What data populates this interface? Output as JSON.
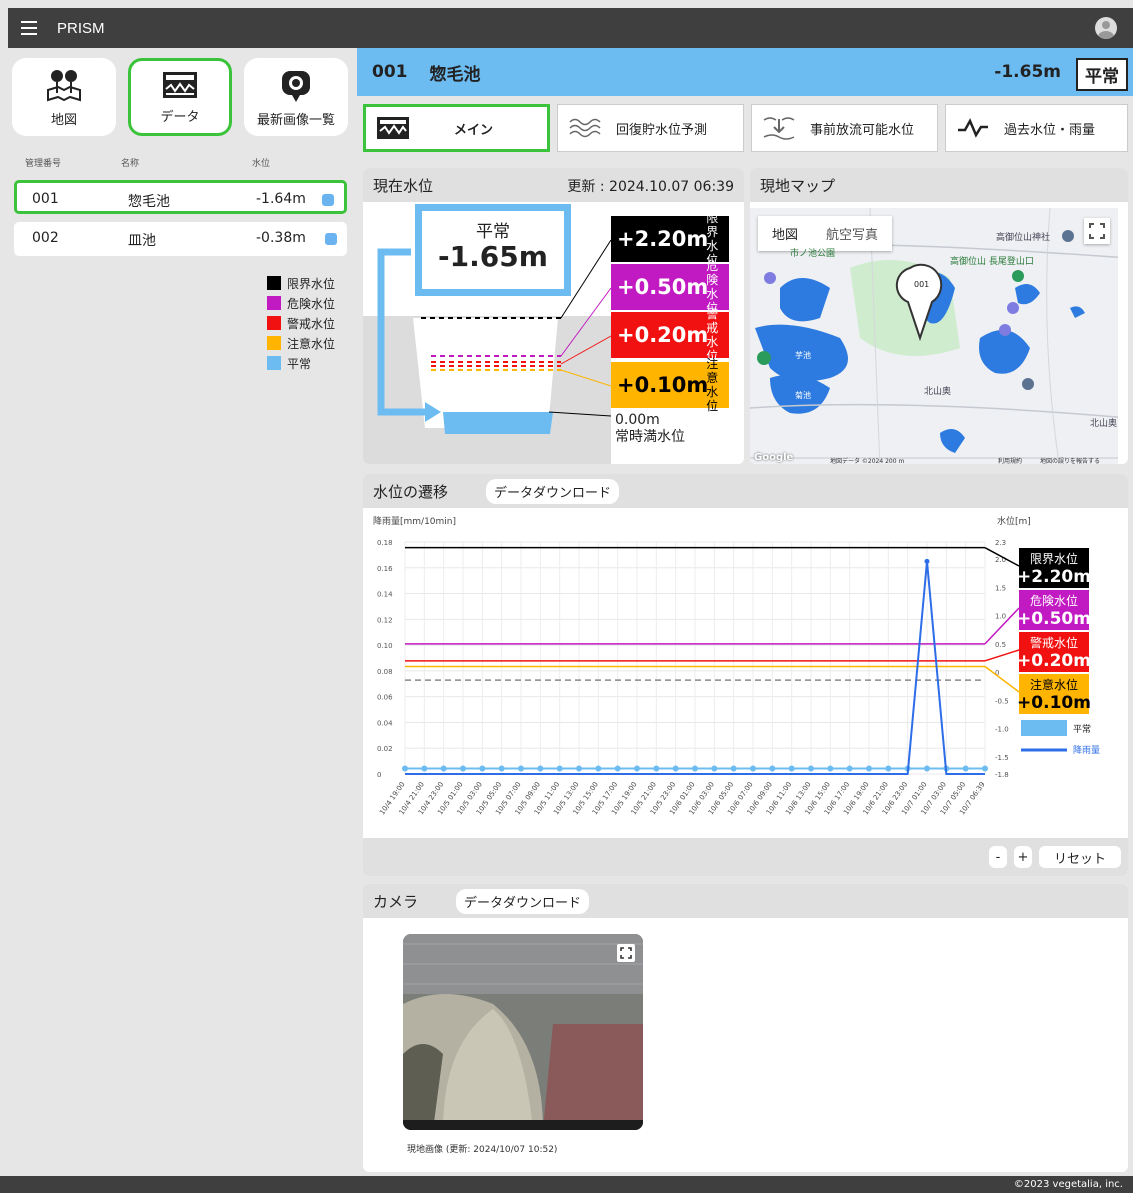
{
  "app": {
    "title": "PRISM"
  },
  "nav": [
    {
      "label": "地図"
    },
    {
      "label": "データ"
    },
    {
      "label": "最新画像一覧"
    }
  ],
  "list": {
    "headers": {
      "id": "管理番号",
      "name": "名称",
      "level": "水位"
    },
    "rows": [
      {
        "id": "001",
        "name": "惣毛池",
        "level": "-1.64m"
      },
      {
        "id": "002",
        "name": "皿池",
        "level": "-0.38m"
      }
    ]
  },
  "legend": [
    {
      "label": "限界水位",
      "color": "#000000"
    },
    {
      "label": "危険水位",
      "color": "#c21ac2"
    },
    {
      "label": "警戒水位",
      "color": "#f21111"
    },
    {
      "label": "注意水位",
      "color": "#ffb400"
    },
    {
      "label": "平常",
      "color": "#6cbcf2"
    }
  ],
  "header": {
    "id": "001",
    "name": "惣毛池",
    "level": "-1.65m",
    "status": "平常"
  },
  "tabs": [
    {
      "label": "メイン"
    },
    {
      "label": "回復貯水位予測"
    },
    {
      "label": "事前放流可能水位"
    },
    {
      "label": "過去水位・雨量"
    }
  ],
  "current": {
    "title": "現在水位",
    "updated": "更新 : 2024.10.07 06:39",
    "status": "平常",
    "value": "-1.65m",
    "thresholds": [
      {
        "value": "+2.20m",
        "label": "限界水位",
        "color": "#000000"
      },
      {
        "value": "+0.50m",
        "label": "危険水位",
        "color": "#c21ac2"
      },
      {
        "value": "+0.20m",
        "label": "警戒水位",
        "color": "#f21111"
      },
      {
        "value": "+0.10m",
        "label": "注意水位",
        "color": "#ffb400"
      }
    ],
    "base_value": "0.00m",
    "base_label": "常時満水位"
  },
  "map": {
    "title": "現地マップ",
    "btn_map": "地図",
    "btn_photo": "航空写真",
    "marker": "001",
    "labels": [
      "高御位山神社",
      "市ノ池公園",
      "高御位山 長尾登山口",
      "北山奥",
      "北山奥",
      "北山奥"
    ],
    "attribution": "地図データ ©2024   200 m",
    "brand": "Google",
    "terms": "利用規約",
    "report": "地図の誤りを報告する",
    "pond1": "芋池",
    "pond2": "菊池",
    "pond3": "北山奥",
    "north_shrine": "北山奥"
  },
  "chart_section": {
    "title": "水位の遷移",
    "download": "データダウンロード",
    "reset": "リセット",
    "minus": "-",
    "plus": "+"
  },
  "chart_data": {
    "type": "line",
    "ylabel_left": "降雨量[mm/10min]",
    "ylabel_right": "水位[m]",
    "y_left_ticks": [
      "0.18",
      "0.16",
      "0.14",
      "0.12",
      "0.10",
      "0.08",
      "0.06",
      "0.04",
      "0.02",
      "0"
    ],
    "y_right_ticks": [
      "2.3",
      "2.0",
      "1.5",
      "1.0",
      "0.5",
      "0",
      "-0.5",
      "-1.0",
      "-1.5",
      "-1.8"
    ],
    "ylim_right": [
      -1.8,
      2.3
    ],
    "x": [
      "10/4 19:00",
      "10/4 21:00",
      "10/4 23:00",
      "10/5 01:00",
      "10/5 03:00",
      "10/5 05:00",
      "10/5 07:00",
      "10/5 09:00",
      "10/5 11:00",
      "10/5 13:00",
      "10/5 15:00",
      "10/5 17:00",
      "10/5 19:00",
      "10/5 21:00",
      "10/5 23:00",
      "10/6 01:00",
      "10/6 03:00",
      "10/6 05:00",
      "10/6 07:00",
      "10/6 09:00",
      "10/6 11:00",
      "10/6 13:00",
      "10/6 15:00",
      "10/6 17:00",
      "10/6 19:00",
      "10/6 21:00",
      "10/6 23:00",
      "10/7 01:00",
      "10/7 03:00",
      "10/7 05:00",
      "10/7 06:39"
    ],
    "thresholds": [
      {
        "name": "限界水位",
        "value": 2.2,
        "label": "+2.20m",
        "color": "#000000"
      },
      {
        "name": "危険水位",
        "value": 0.5,
        "label": "+0.50m",
        "color": "#c21ac2"
      },
      {
        "name": "警戒水位",
        "value": 0.2,
        "label": "+0.20m",
        "color": "#f21111"
      },
      {
        "name": "注意水位",
        "value": 0.1,
        "label": "+0.10m",
        "color": "#ffb400"
      }
    ],
    "series": [
      {
        "name": "平常",
        "values": [
          -1.65,
          -1.65,
          -1.65,
          -1.65,
          -1.65,
          -1.65,
          -1.65,
          -1.65,
          -1.65,
          -1.65,
          -1.65,
          -1.65,
          -1.65,
          -1.65,
          -1.65,
          -1.65,
          -1.65,
          -1.65,
          -1.65,
          -1.65,
          -1.65,
          -1.65,
          -1.65,
          -1.65,
          -1.65,
          -1.65,
          -1.65,
          -1.65,
          -1.65,
          -1.65,
          -1.65
        ],
        "color": "#6cbcf2"
      },
      {
        "name": "降雨量",
        "values": [
          0,
          0,
          0,
          0,
          0,
          0,
          0,
          0,
          0,
          0,
          0,
          0,
          0,
          0,
          0,
          0,
          0,
          0,
          0,
          0,
          0,
          0,
          0,
          0,
          0,
          0,
          0,
          0.165,
          0,
          0,
          0
        ],
        "color": "#2d6de8"
      }
    ]
  },
  "camera": {
    "title": "カメラ",
    "download": "データダウンロード",
    "caption": "現地画像 (更新: 2024/10/07 10:52)"
  },
  "footer": "©2023 vegetalia, inc."
}
